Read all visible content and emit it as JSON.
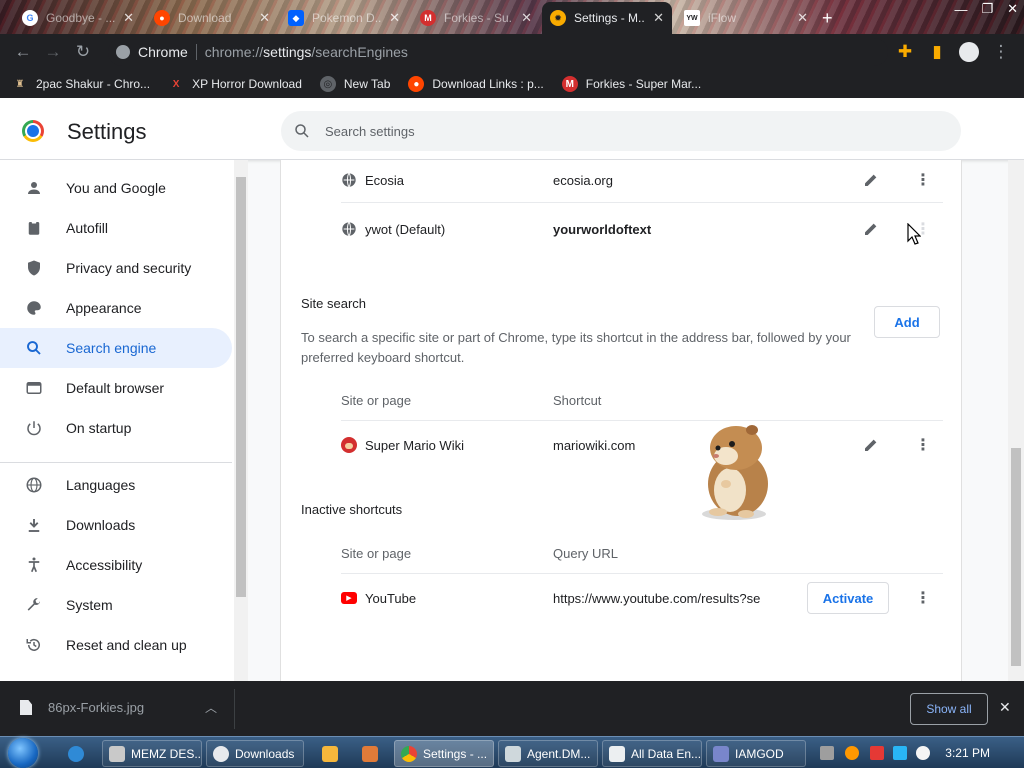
{
  "tabs": [
    {
      "label": "Goodbye - ...",
      "fav": "google",
      "active": false
    },
    {
      "label": "Download",
      "fav": "reddit",
      "active": false
    },
    {
      "label": "Pokemon D...",
      "fav": "dropbox",
      "active": false
    },
    {
      "label": "Forkies - Su...",
      "fav": "mario",
      "active": false
    },
    {
      "label": "Settings - M...",
      "fav": "settings",
      "active": true
    },
    {
      "label": "iFlow",
      "fav": "yw",
      "active": false
    }
  ],
  "toolbar": {
    "site_label": "Chrome",
    "url_scheme": "chrome://",
    "url_host": "settings",
    "url_path": "/searchEngines"
  },
  "bookmarks": [
    {
      "label": "2pac Shakur - Chro...",
      "icon": "chess-icon"
    },
    {
      "label": "XP Horror Download",
      "icon": "x-icon"
    },
    {
      "label": "New Tab",
      "icon": "globe-icon"
    },
    {
      "label": "Download Links : p...",
      "icon": "reddit-icon"
    },
    {
      "label": "Forkies - Super Mar...",
      "icon": "mario-icon"
    }
  ],
  "settings": {
    "title": "Settings",
    "search_placeholder": "Search settings",
    "nav": [
      {
        "label": "You and Google",
        "icon": "person-icon",
        "selected": false
      },
      {
        "label": "Autofill",
        "icon": "clipboard-icon",
        "selected": false
      },
      {
        "label": "Privacy and security",
        "icon": "shield-icon",
        "selected": false
      },
      {
        "label": "Appearance",
        "icon": "palette-icon",
        "selected": false
      },
      {
        "label": "Search engine",
        "icon": "search-icon",
        "selected": true
      },
      {
        "label": "Default browser",
        "icon": "browser-icon",
        "selected": false
      },
      {
        "label": "On startup",
        "icon": "power-icon",
        "selected": false
      },
      {
        "label": "Languages",
        "icon": "globe-icon",
        "selected": false
      },
      {
        "label": "Downloads",
        "icon": "download-icon",
        "selected": false
      },
      {
        "label": "Accessibility",
        "icon": "accessibility-icon",
        "selected": false
      },
      {
        "label": "System",
        "icon": "wrench-icon",
        "selected": false
      },
      {
        "label": "Reset and clean up",
        "icon": "restore-icon",
        "selected": false
      }
    ]
  },
  "search_engines": [
    {
      "name": "Ecosia",
      "keyword": "ecosia.org"
    },
    {
      "name": "ywot (Default)",
      "keyword": "yourworldoftext"
    }
  ],
  "site_search": {
    "heading": "Site search",
    "add_label": "Add",
    "description": "To search a specific site or part of Chrome, type its shortcut in the address bar, followed by your preferred keyboard shortcut.",
    "col_site": "Site or page",
    "col_shortcut": "Shortcut",
    "rows": [
      {
        "name": "Super Mario Wiki",
        "shortcut": "mariowiki.com"
      }
    ]
  },
  "inactive": {
    "heading": "Inactive shortcuts",
    "col_site": "Site or page",
    "col_query": "Query URL",
    "rows": [
      {
        "name": "YouTube",
        "url": "https://www.youtube.com/results?se",
        "action": "Activate"
      }
    ]
  },
  "download_shelf": {
    "file": "86px-Forkies.jpg",
    "show_all": "Show all"
  },
  "taskbar": {
    "items": [
      {
        "label": "MEMZ DES..."
      },
      {
        "label": "Downloads"
      },
      {
        "label": "Settings - ..."
      },
      {
        "label": "Agent.DM..."
      },
      {
        "label": "All Data En..."
      },
      {
        "label": "IAMGOD"
      }
    ],
    "clock": "3:21 PM"
  },
  "colors": {
    "accent": "#1a73e8",
    "selected_bg": "#e8f0fe",
    "toolbar": "#202124"
  }
}
